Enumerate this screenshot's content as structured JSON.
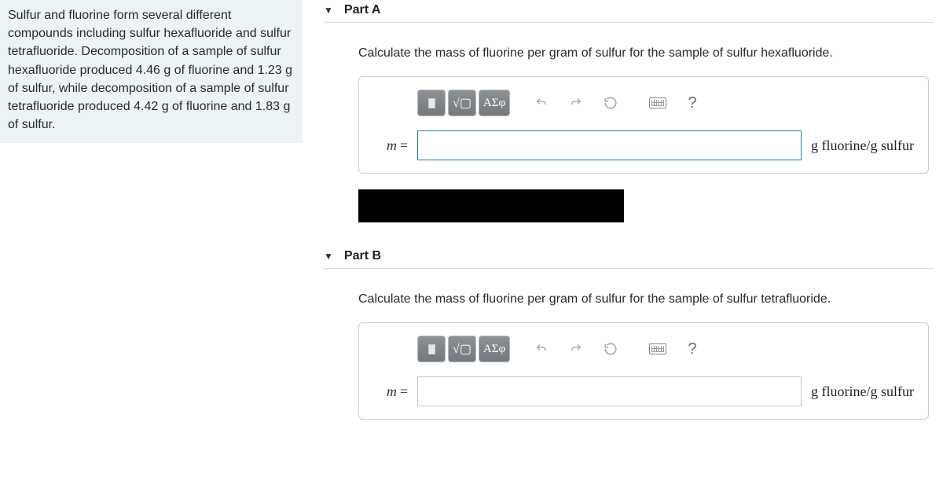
{
  "problem": {
    "text": "Sulfur and fluorine form several different compounds including sulfur hexafluoride and sulfur tetrafluoride. Decomposition of a sample of sulfur hexafluoride produced 4.46 g of fluorine and 1.23 g of sulfur, while decomposition of a sample of sulfur tetrafluoride produced 4.42 g of fluorine and 1.83 g of sulfur."
  },
  "parts": {
    "a": {
      "title": "Part A",
      "prompt": "Calculate the mass of fluorine per gram of sulfur for the sample of sulfur hexafluoride.",
      "variable": "m",
      "equals": "=",
      "value": "",
      "units": "g fluorine/g sulfur"
    },
    "b": {
      "title": "Part B",
      "prompt": "Calculate the mass of fluorine per gram of sulfur for the sample of sulfur tetrafluoride.",
      "variable": "m",
      "equals": "=",
      "value": "",
      "units": "g fluorine/g sulfur"
    }
  },
  "toolbar": {
    "templates": "▮",
    "root": "ᵡ√▢",
    "greek": "ΑΣφ",
    "undo": "undo",
    "redo": "redo",
    "reset": "reset",
    "keyboard": "keyboard",
    "help": "?"
  }
}
